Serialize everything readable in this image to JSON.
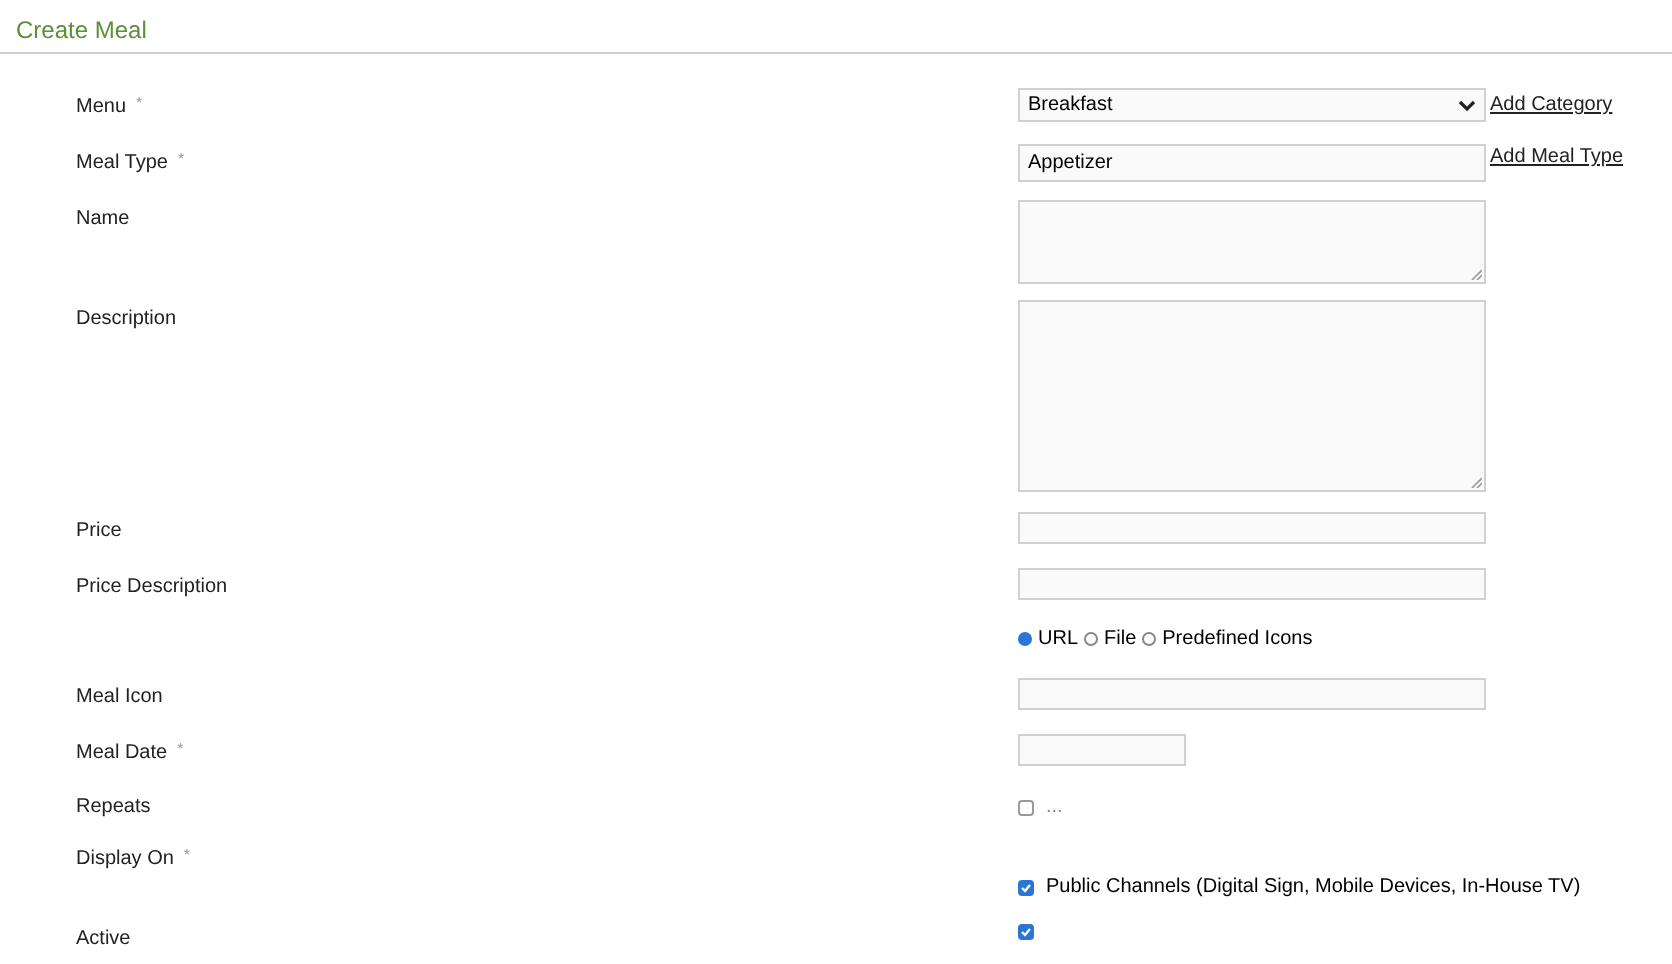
{
  "title": "Create Meal",
  "rows": [
    {
      "kind": "select",
      "label": "Menu",
      "required_mark": "*",
      "value": "Breakfast",
      "link": "Add Category"
    },
    {
      "kind": "input",
      "label": "Meal Type",
      "required_mark": "*",
      "value": "Appetizer",
      "link": "Add Meal Type"
    },
    {
      "kind": "short_text",
      "label": "Name"
    },
    {
      "kind": "long_text",
      "label": "Description"
    },
    {
      "kind": "input",
      "label": "Price"
    },
    {
      "kind": "input",
      "label": "Price Description"
    },
    {
      "kind": "radios",
      "options": [
        {
          "label": "URL",
          "selected": true
        },
        {
          "label": "File",
          "selected": false
        },
        {
          "label": "Predefined Icons",
          "selected": false
        }
      ]
    },
    {
      "kind": "input",
      "label": "Meal Icon"
    },
    {
      "kind": "date",
      "label": "Meal Date",
      "required_mark": "*"
    },
    {
      "kind": "checkbox",
      "label": "Repeats",
      "checked": false,
      "text": "..."
    },
    {
      "kind": "checkbox_below",
      "label": "Display On",
      "required_mark": "*",
      "checked": true,
      "text": "Public Channels (Digital Sign, Mobile Devices, In-House TV)"
    },
    {
      "kind": "checkbox",
      "label": "Active",
      "checked": true
    }
  ]
}
